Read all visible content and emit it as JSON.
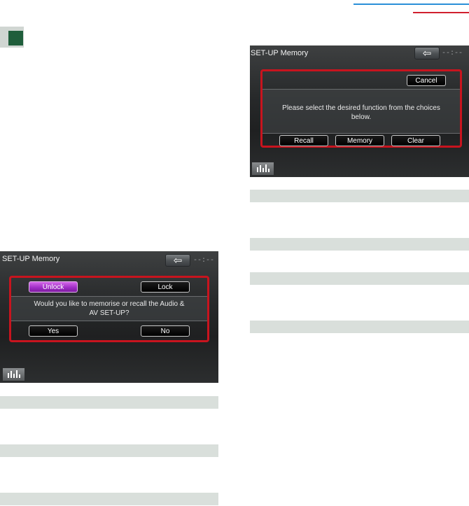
{
  "screen_left": {
    "title": "SET-UP Memory",
    "time": "--:--",
    "buttons": {
      "unlock": "Unlock",
      "lock": "Lock",
      "yes": "Yes",
      "no": "No"
    },
    "message": "Would you like to memorise or recall the Audio &\nAV SET-UP?"
  },
  "screen_right": {
    "title": "SET-UP Memory",
    "time": "--:--",
    "buttons": {
      "cancel": "Cancel",
      "recall": "Recall",
      "memory": "Memory",
      "clear": "Clear"
    },
    "message": "Please select the desired function from the choices\nbelow."
  },
  "colors": {
    "header_blue": "#2a8fd8",
    "header_red": "#d0202e",
    "section_marker": "#1f5e3b",
    "highlight_frame": "#c8141e",
    "unlock_active": "#a12ec7",
    "row_bar": "#d9dfdb"
  }
}
